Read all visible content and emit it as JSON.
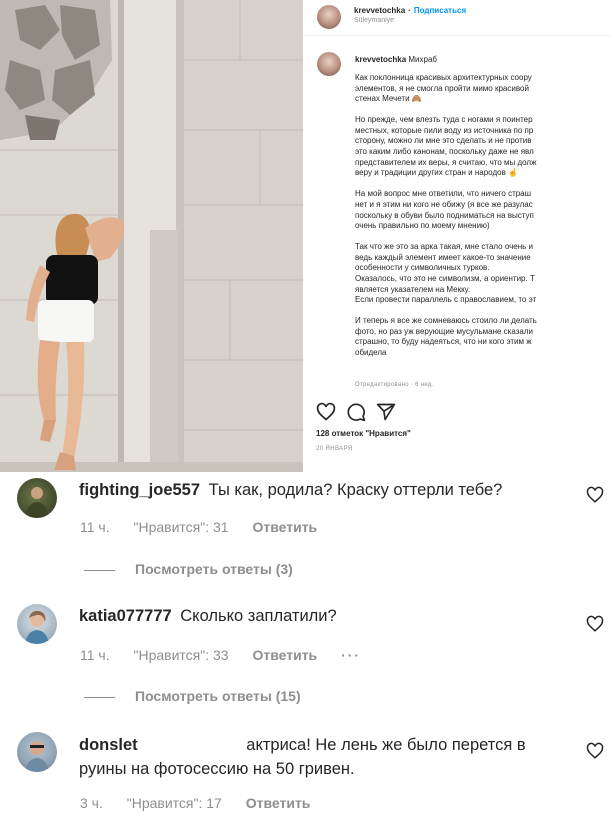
{
  "post": {
    "username": "krevvetochka",
    "follow_label": "Подписаться",
    "location": "Süleymaniye",
    "caption_title": "Михраб",
    "caption_paragraphs": [
      [
        "Как поклонница красивых архитектурных соору",
        "элементов, я не смогла пройти мимо красивой",
        "стенах Мечети 🙈"
      ],
      [
        "Но прежде, чем влезть туда с ногами я поинтер",
        "местных, которые пили воду из источника по пр",
        "сторону, можно ли мне это сделать и не против",
        "это каким либо канонам, поскольку даже не явл",
        "представителем их веры, я считаю, что мы долж",
        "веру и традиции других стран и народов ☝️"
      ],
      [
        "На мой вопрос мне ответили, что ничего страш",
        "нет и я этим ни кого не обижу (я все же разулас",
        "поскольку в обуви было подниматься на выступ",
        "очень правильно по моему мнению)"
      ],
      [
        "Так что же это за арка такая, мне стало очень и",
        "ведь каждый элемент имеет какое-то значение",
        "особенности у символичных турков.",
        "Оказалось, что это не символизм, а ориентир. Т",
        "является указателем на Мекку.",
        "Если провести параллель с православием, то эт"
      ],
      [
        "И теперь я все же сомневаюсь стоило ли делать",
        "фото, но раз уж верующие мусульмане сказали",
        "страшно, то буду надеяться, что ни кого этим ж",
        "обидела"
      ]
    ],
    "edited_label": "Отредактировано · 6 нед.",
    "likes_label": "128 отметок \"Нравится\"",
    "date_label": "20 ЯНВАРЯ",
    "icons": [
      "heart-icon",
      "comment-icon",
      "share-icon"
    ]
  },
  "comments": [
    {
      "username": "fighting_joe557",
      "text": "Ты как, родила? Краску оттерли тебе?",
      "time": "11 ч.",
      "likes": "\"Нравится\": 31",
      "reply_label": "Ответить",
      "view_replies": "Посмотреть ответы (3)"
    },
    {
      "username": "katia077777",
      "text": "Сколько заплатили?",
      "time": "11 ч.",
      "likes": "\"Нравится\": 33",
      "reply_label": "Ответить",
      "more": "···",
      "view_replies": "Посмотреть ответы (15)"
    },
    {
      "username": "donslet",
      "text_line1": "актриса! Не лень же было перется в",
      "text_line2": "руины на фотосессию на 50 гривен.",
      "time": "3 ч.",
      "likes": "\"Нравится\": 17",
      "reply_label": "Ответить"
    }
  ],
  "colors": {
    "link": "#0095f6",
    "muted": "#8e8e8e",
    "text": "#262626"
  }
}
